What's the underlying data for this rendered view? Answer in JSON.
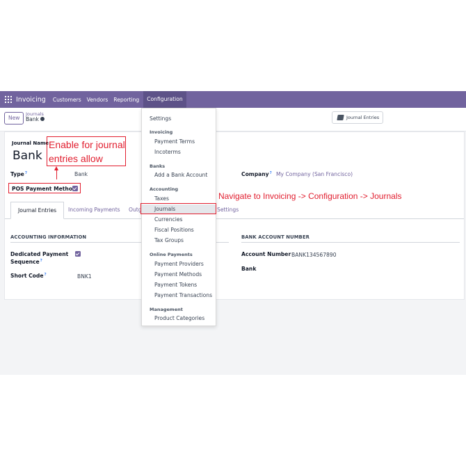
{
  "navbar": {
    "app_name": "Invoicing",
    "items": [
      "Customers",
      "Vendors",
      "Reporting",
      "Configuration"
    ]
  },
  "control": {
    "new_label": "New",
    "breadcrumb_parent": "Journals",
    "breadcrumb_current": "Bank",
    "journal_entries_label": "Journal Entries"
  },
  "form": {
    "journal_name_label": "Journal Name",
    "journal_name_value": "Bank",
    "type_label": "Type",
    "type_value": "Bank",
    "tooltip_mark": "?",
    "pos_label": "POS Payment Method",
    "company_label": "Company",
    "company_value": "My Company (San Francisco)",
    "tabs": [
      "Journal Entries",
      "Incoming Payments",
      "Outg",
      "Settings"
    ],
    "accounting_info_heading": "ACCOUNTING INFORMATION",
    "dedicated_label_1": "Dedicated Payment",
    "dedicated_label_2": "Sequence",
    "short_code_label": "Short Code",
    "short_code_value": "BNK1",
    "bank_account_heading": "BANK ACCOUNT NUMBER",
    "account_number_label": "Account Number",
    "account_number_value": "BANK134567890",
    "bank_label": "Bank"
  },
  "dropdown": {
    "settings": "Settings",
    "invoicing_head": "Invoicing",
    "payment_terms": "Payment Terms",
    "incoterms": "Incoterms",
    "banks_head": "Banks",
    "add_bank_account": "Add a Bank Account",
    "accounting_head": "Accounting",
    "taxes": "Taxes",
    "journals": "Journals",
    "currencies": "Currencies",
    "fiscal_positions": "Fiscal Positions",
    "tax_groups": "Tax Groups",
    "online_payments_head": "Online Payments",
    "payment_providers": "Payment Providers",
    "payment_methods": "Payment Methods",
    "payment_tokens": "Payment Tokens",
    "payment_transactions": "Payment Transactions",
    "management_head": "Management",
    "product_categories": "Product Categories"
  },
  "annotations": {
    "enable_line1": "Enable for journal",
    "enable_line2": "entries allow",
    "navigate": "Navigate to Invoicing -> Configuration -> Journals"
  },
  "colors": {
    "brand": "#71639e",
    "annotation_red": "#e11d2e"
  }
}
